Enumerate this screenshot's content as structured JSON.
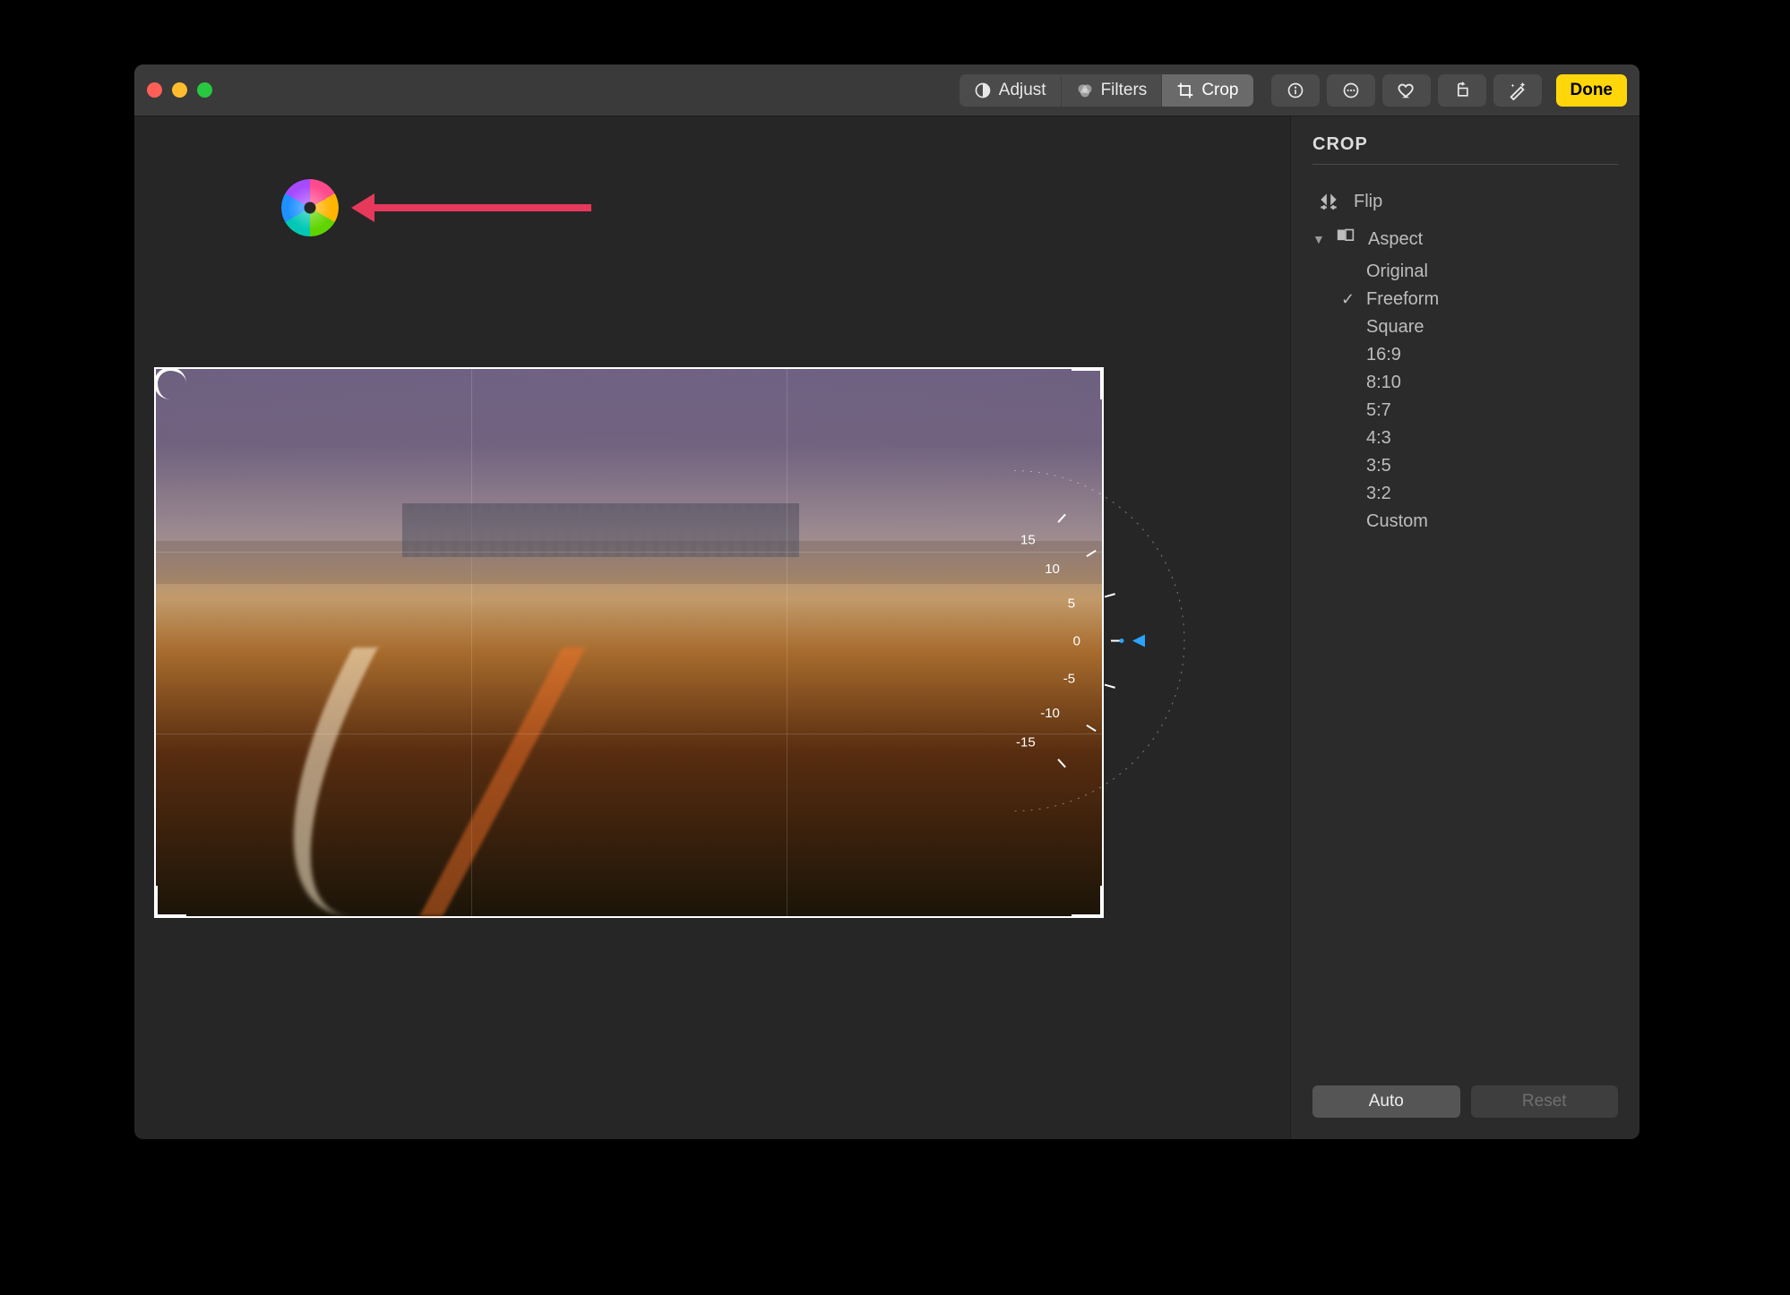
{
  "toolbar": {
    "tabs": [
      {
        "label": "Adjust",
        "icon": "adjust-icon",
        "active": false
      },
      {
        "label": "Filters",
        "icon": "filters-icon",
        "active": false
      },
      {
        "label": "Crop",
        "icon": "crop-icon",
        "active": true
      }
    ],
    "right_icons": [
      "info-icon",
      "more-icon",
      "favorite-icon",
      "rotate-icon",
      "enhance-icon"
    ],
    "done_label": "Done"
  },
  "sidebar": {
    "title": "CROP",
    "flip_label": "Flip",
    "aspect_label": "Aspect",
    "aspect_expanded": true,
    "aspect_options": [
      {
        "label": "Original",
        "selected": false
      },
      {
        "label": "Freeform",
        "selected": true
      },
      {
        "label": "Square",
        "selected": false
      },
      {
        "label": "16:9",
        "selected": false
      },
      {
        "label": "8:10",
        "selected": false
      },
      {
        "label": "5:7",
        "selected": false
      },
      {
        "label": "4:3",
        "selected": false
      },
      {
        "label": "3:5",
        "selected": false
      },
      {
        "label": "3:2",
        "selected": false
      },
      {
        "label": "Custom",
        "selected": false
      }
    ],
    "auto_label": "Auto",
    "reset_label": "Reset",
    "reset_enabled": false
  },
  "dial": {
    "ticks": [
      "15",
      "10",
      "5",
      "0",
      "-5",
      "-10",
      "-15"
    ],
    "current_value": "0"
  },
  "annotation": {
    "spinner": "macos-beachball-cursor"
  }
}
